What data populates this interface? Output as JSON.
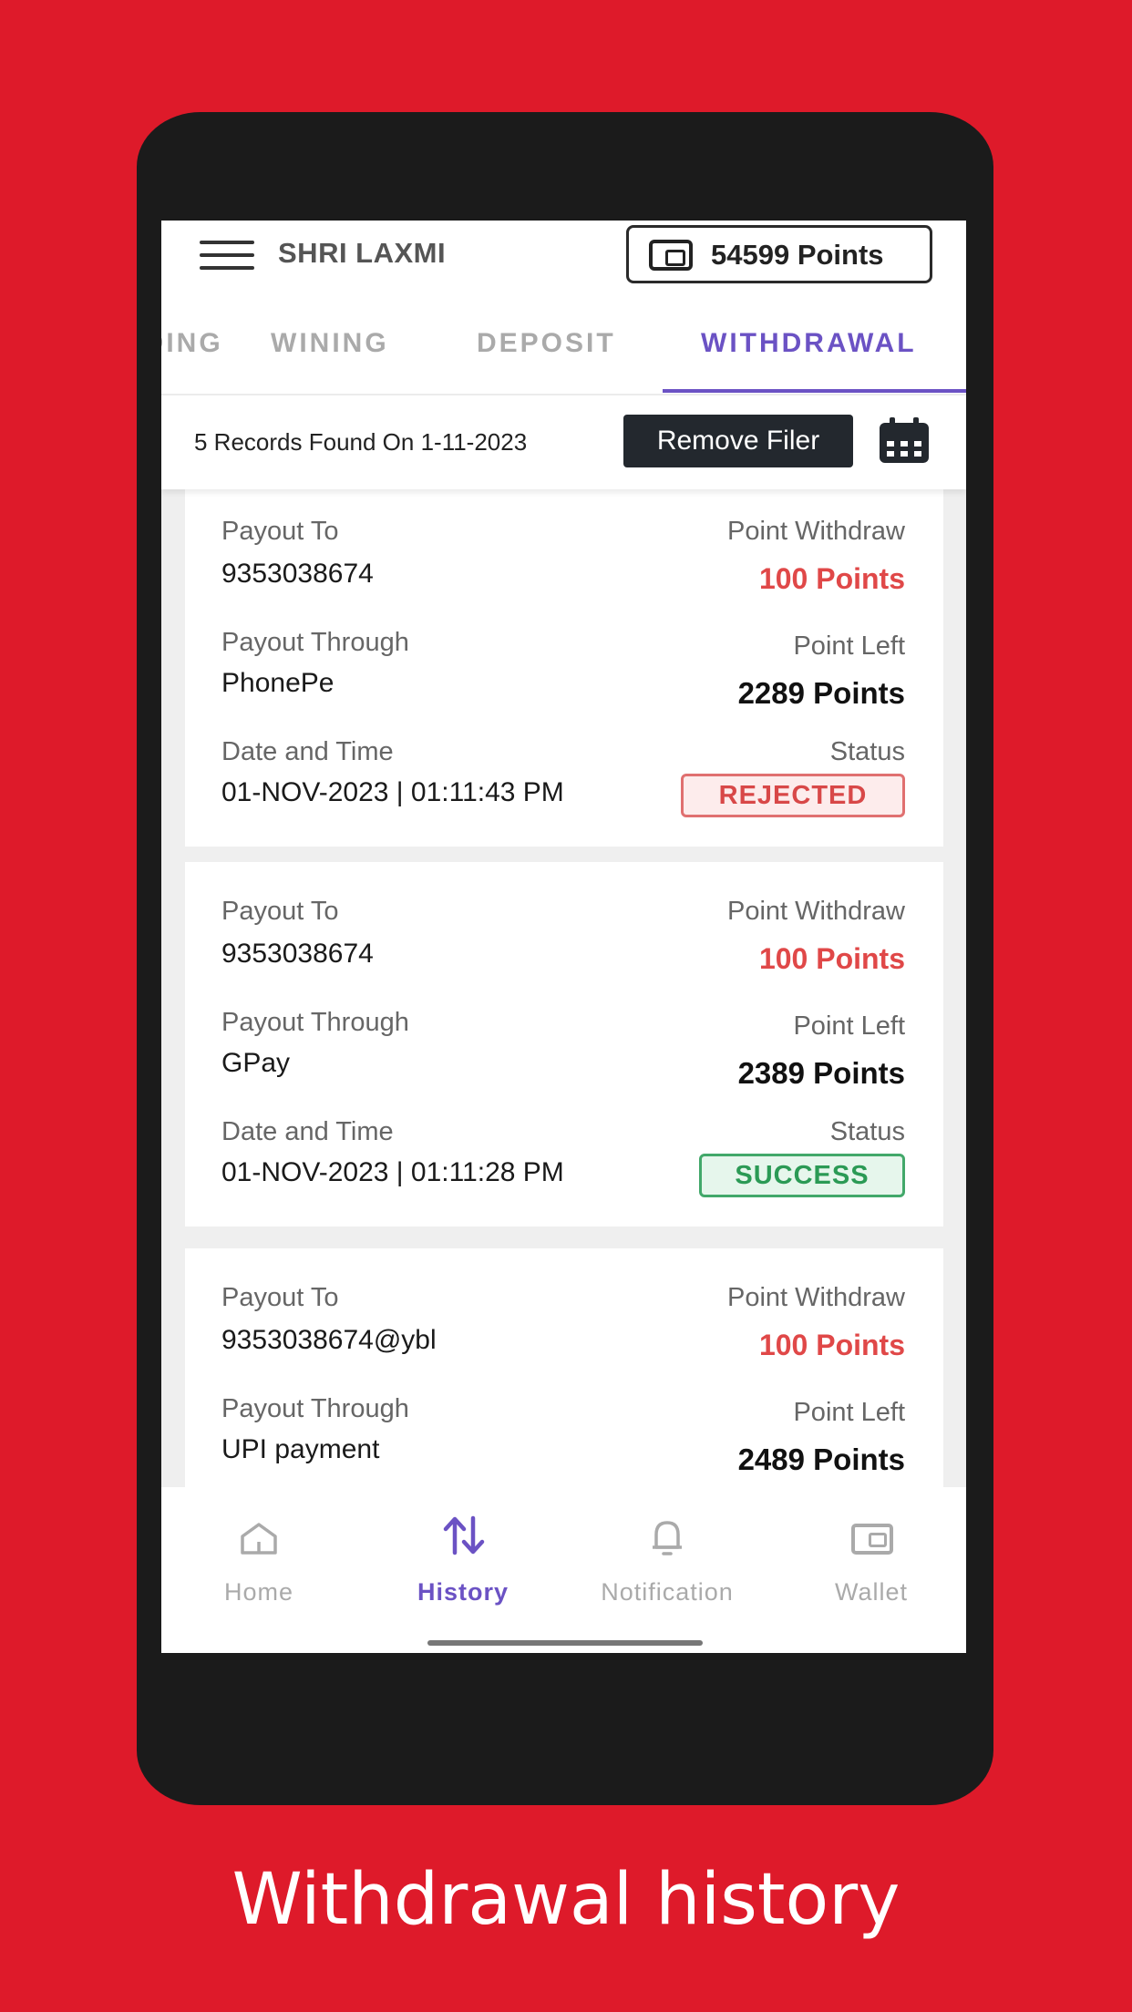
{
  "header": {
    "app_title": "SHRI LAXMI",
    "points": "54599 Points"
  },
  "tabs": [
    {
      "label": "BIDDING"
    },
    {
      "label": "WINING"
    },
    {
      "label": "DEPOSIT"
    },
    {
      "label": "WITHDRAWAL",
      "active": true
    }
  ],
  "filter": {
    "records_text": "5 Records Found On 1-11-2023",
    "remove_label": "Remove Filer"
  },
  "labels": {
    "payout_to": "Payout To",
    "payout_through": "Payout Through",
    "date_time": "Date and Time",
    "point_withdraw": "Point Withdraw",
    "point_left": "Point Left",
    "status": "Status"
  },
  "records": [
    {
      "payout_to": "9353038674",
      "payout_through": "PhonePe",
      "date_time": "01-NOV-2023 | 01:11:43 PM",
      "withdraw": "100 Points",
      "left": "2289 Points",
      "status": "REJECTED"
    },
    {
      "payout_to": "9353038674",
      "payout_through": "GPay",
      "date_time": "01-NOV-2023 | 01:11:28 PM",
      "withdraw": "100 Points",
      "left": "2389 Points",
      "status": "SUCCESS"
    },
    {
      "payout_to": "9353038674@ybl",
      "payout_through": "UPI payment",
      "withdraw": "100 Points",
      "left": "2489 Points"
    }
  ],
  "bottom_nav": [
    {
      "label": "Home",
      "icon": "home-icon"
    },
    {
      "label": "History",
      "icon": "history-icon",
      "active": true
    },
    {
      "label": "Notification",
      "icon": "bell-icon"
    },
    {
      "label": "Wallet",
      "icon": "wallet-icon"
    }
  ],
  "caption": "Withdrawal history",
  "colors": {
    "background": "#de1a2a",
    "accent": "#6b52c4",
    "reject": "#d84848",
    "success": "#2b9a55"
  }
}
